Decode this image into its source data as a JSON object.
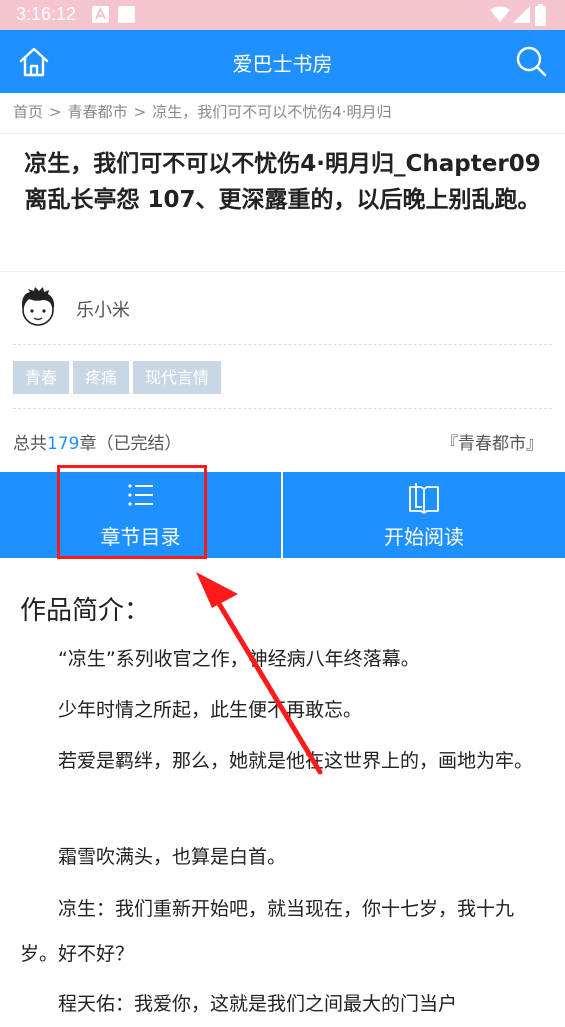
{
  "status_bar": {
    "time": "3:16:12"
  },
  "header": {
    "title": "爱巴士书房"
  },
  "breadcrumb": {
    "home": "首页",
    "sep": ">",
    "category": "青春都市",
    "current": "凉生，我们可不可以不忧伤4·明月归"
  },
  "book": {
    "title": "凉生，我们可不可以不忧伤4·明月归_Chapter09 离乱长亭怨 107、更深露重的，以后晚上别乱跑。",
    "author": "乐小米",
    "tags": [
      "青春",
      "疼痛",
      "现代言情"
    ],
    "total_prefix": "总共",
    "chapter_count": "179",
    "total_suffix": "章（已完结）",
    "category": "『青春都市』"
  },
  "actions": {
    "toc_label": "章节目录",
    "read_label": "开始阅读"
  },
  "intro": {
    "heading": "作品简介：",
    "paragraphs": [
      "“凉生”系列收官之作，神经病八年终落幕。",
      "少年时情之所起，此生便不再敢忘。",
      "若爱是羁绊，那么，她就是他在这世界上的，画地为牢。",
      "霜雪吹满头，也算是白首。",
      "凉生：我们重新开始吧，就当现在，你十七岁，我十九岁。好不好？",
      "程天佑：我爱你，这就是我们之间最大的门当户"
    ]
  },
  "colors": {
    "accent": "#1e90ff",
    "status_bar": "#f4c4cf",
    "annotation": "#ff1a1a",
    "tag_bg": "#c8d6e5"
  }
}
